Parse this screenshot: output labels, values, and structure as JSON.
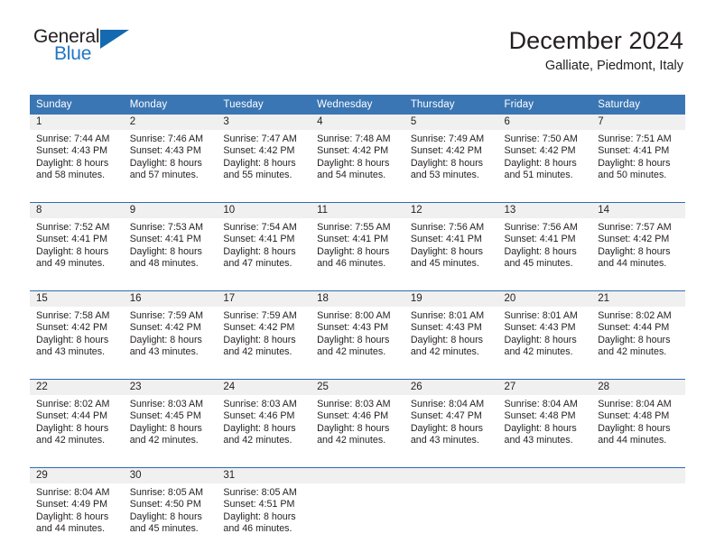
{
  "brand": {
    "name_part1": "General",
    "name_part2": "Blue",
    "triangle_color": "#1469b0",
    "blue_color": "#1f77c4"
  },
  "header": {
    "title": "December 2024",
    "subtitle": "Galliate, Piedmont, Italy"
  },
  "theme": {
    "header_row_bg": "#3b76b4",
    "daynum_band_bg": "#f0f0f0",
    "row_divider": "#2f6cae",
    "text": "#231f20"
  },
  "calendar": {
    "weekday_headers": [
      "Sunday",
      "Monday",
      "Tuesday",
      "Wednesday",
      "Thursday",
      "Friday",
      "Saturday"
    ],
    "labels": {
      "sunrise_prefix": "Sunrise:",
      "sunset_prefix": "Sunset:",
      "daylight_prefix": "Daylight:"
    },
    "weeks": [
      [
        {
          "day": "1",
          "sunrise": "Sunrise: 7:44 AM",
          "sunset": "Sunset: 4:43 PM",
          "daylight_line1": "Daylight: 8 hours",
          "daylight_line2": "and 58 minutes."
        },
        {
          "day": "2",
          "sunrise": "Sunrise: 7:46 AM",
          "sunset": "Sunset: 4:43 PM",
          "daylight_line1": "Daylight: 8 hours",
          "daylight_line2": "and 57 minutes."
        },
        {
          "day": "3",
          "sunrise": "Sunrise: 7:47 AM",
          "sunset": "Sunset: 4:42 PM",
          "daylight_line1": "Daylight: 8 hours",
          "daylight_line2": "and 55 minutes."
        },
        {
          "day": "4",
          "sunrise": "Sunrise: 7:48 AM",
          "sunset": "Sunset: 4:42 PM",
          "daylight_line1": "Daylight: 8 hours",
          "daylight_line2": "and 54 minutes."
        },
        {
          "day": "5",
          "sunrise": "Sunrise: 7:49 AM",
          "sunset": "Sunset: 4:42 PM",
          "daylight_line1": "Daylight: 8 hours",
          "daylight_line2": "and 53 minutes."
        },
        {
          "day": "6",
          "sunrise": "Sunrise: 7:50 AM",
          "sunset": "Sunset: 4:42 PM",
          "daylight_line1": "Daylight: 8 hours",
          "daylight_line2": "and 51 minutes."
        },
        {
          "day": "7",
          "sunrise": "Sunrise: 7:51 AM",
          "sunset": "Sunset: 4:41 PM",
          "daylight_line1": "Daylight: 8 hours",
          "daylight_line2": "and 50 minutes."
        }
      ],
      [
        {
          "day": "8",
          "sunrise": "Sunrise: 7:52 AM",
          "sunset": "Sunset: 4:41 PM",
          "daylight_line1": "Daylight: 8 hours",
          "daylight_line2": "and 49 minutes."
        },
        {
          "day": "9",
          "sunrise": "Sunrise: 7:53 AM",
          "sunset": "Sunset: 4:41 PM",
          "daylight_line1": "Daylight: 8 hours",
          "daylight_line2": "and 48 minutes."
        },
        {
          "day": "10",
          "sunrise": "Sunrise: 7:54 AM",
          "sunset": "Sunset: 4:41 PM",
          "daylight_line1": "Daylight: 8 hours",
          "daylight_line2": "and 47 minutes."
        },
        {
          "day": "11",
          "sunrise": "Sunrise: 7:55 AM",
          "sunset": "Sunset: 4:41 PM",
          "daylight_line1": "Daylight: 8 hours",
          "daylight_line2": "and 46 minutes."
        },
        {
          "day": "12",
          "sunrise": "Sunrise: 7:56 AM",
          "sunset": "Sunset: 4:41 PM",
          "daylight_line1": "Daylight: 8 hours",
          "daylight_line2": "and 45 minutes."
        },
        {
          "day": "13",
          "sunrise": "Sunrise: 7:56 AM",
          "sunset": "Sunset: 4:41 PM",
          "daylight_line1": "Daylight: 8 hours",
          "daylight_line2": "and 45 minutes."
        },
        {
          "day": "14",
          "sunrise": "Sunrise: 7:57 AM",
          "sunset": "Sunset: 4:42 PM",
          "daylight_line1": "Daylight: 8 hours",
          "daylight_line2": "and 44 minutes."
        }
      ],
      [
        {
          "day": "15",
          "sunrise": "Sunrise: 7:58 AM",
          "sunset": "Sunset: 4:42 PM",
          "daylight_line1": "Daylight: 8 hours",
          "daylight_line2": "and 43 minutes."
        },
        {
          "day": "16",
          "sunrise": "Sunrise: 7:59 AM",
          "sunset": "Sunset: 4:42 PM",
          "daylight_line1": "Daylight: 8 hours",
          "daylight_line2": "and 43 minutes."
        },
        {
          "day": "17",
          "sunrise": "Sunrise: 7:59 AM",
          "sunset": "Sunset: 4:42 PM",
          "daylight_line1": "Daylight: 8 hours",
          "daylight_line2": "and 42 minutes."
        },
        {
          "day": "18",
          "sunrise": "Sunrise: 8:00 AM",
          "sunset": "Sunset: 4:43 PM",
          "daylight_line1": "Daylight: 8 hours",
          "daylight_line2": "and 42 minutes."
        },
        {
          "day": "19",
          "sunrise": "Sunrise: 8:01 AM",
          "sunset": "Sunset: 4:43 PM",
          "daylight_line1": "Daylight: 8 hours",
          "daylight_line2": "and 42 minutes."
        },
        {
          "day": "20",
          "sunrise": "Sunrise: 8:01 AM",
          "sunset": "Sunset: 4:43 PM",
          "daylight_line1": "Daylight: 8 hours",
          "daylight_line2": "and 42 minutes."
        },
        {
          "day": "21",
          "sunrise": "Sunrise: 8:02 AM",
          "sunset": "Sunset: 4:44 PM",
          "daylight_line1": "Daylight: 8 hours",
          "daylight_line2": "and 42 minutes."
        }
      ],
      [
        {
          "day": "22",
          "sunrise": "Sunrise: 8:02 AM",
          "sunset": "Sunset: 4:44 PM",
          "daylight_line1": "Daylight: 8 hours",
          "daylight_line2": "and 42 minutes."
        },
        {
          "day": "23",
          "sunrise": "Sunrise: 8:03 AM",
          "sunset": "Sunset: 4:45 PM",
          "daylight_line1": "Daylight: 8 hours",
          "daylight_line2": "and 42 minutes."
        },
        {
          "day": "24",
          "sunrise": "Sunrise: 8:03 AM",
          "sunset": "Sunset: 4:46 PM",
          "daylight_line1": "Daylight: 8 hours",
          "daylight_line2": "and 42 minutes."
        },
        {
          "day": "25",
          "sunrise": "Sunrise: 8:03 AM",
          "sunset": "Sunset: 4:46 PM",
          "daylight_line1": "Daylight: 8 hours",
          "daylight_line2": "and 42 minutes."
        },
        {
          "day": "26",
          "sunrise": "Sunrise: 8:04 AM",
          "sunset": "Sunset: 4:47 PM",
          "daylight_line1": "Daylight: 8 hours",
          "daylight_line2": "and 43 minutes."
        },
        {
          "day": "27",
          "sunrise": "Sunrise: 8:04 AM",
          "sunset": "Sunset: 4:48 PM",
          "daylight_line1": "Daylight: 8 hours",
          "daylight_line2": "and 43 minutes."
        },
        {
          "day": "28",
          "sunrise": "Sunrise: 8:04 AM",
          "sunset": "Sunset: 4:48 PM",
          "daylight_line1": "Daylight: 8 hours",
          "daylight_line2": "and 44 minutes."
        }
      ],
      [
        {
          "day": "29",
          "sunrise": "Sunrise: 8:04 AM",
          "sunset": "Sunset: 4:49 PM",
          "daylight_line1": "Daylight: 8 hours",
          "daylight_line2": "and 44 minutes."
        },
        {
          "day": "30",
          "sunrise": "Sunrise: 8:05 AM",
          "sunset": "Sunset: 4:50 PM",
          "daylight_line1": "Daylight: 8 hours",
          "daylight_line2": "and 45 minutes."
        },
        {
          "day": "31",
          "sunrise": "Sunrise: 8:05 AM",
          "sunset": "Sunset: 4:51 PM",
          "daylight_line1": "Daylight: 8 hours",
          "daylight_line2": "and 46 minutes."
        },
        {
          "day": "",
          "sunrise": "",
          "sunset": "",
          "daylight_line1": "",
          "daylight_line2": ""
        },
        {
          "day": "",
          "sunrise": "",
          "sunset": "",
          "daylight_line1": "",
          "daylight_line2": ""
        },
        {
          "day": "",
          "sunrise": "",
          "sunset": "",
          "daylight_line1": "",
          "daylight_line2": ""
        },
        {
          "day": "",
          "sunrise": "",
          "sunset": "",
          "daylight_line1": "",
          "daylight_line2": ""
        }
      ]
    ]
  }
}
